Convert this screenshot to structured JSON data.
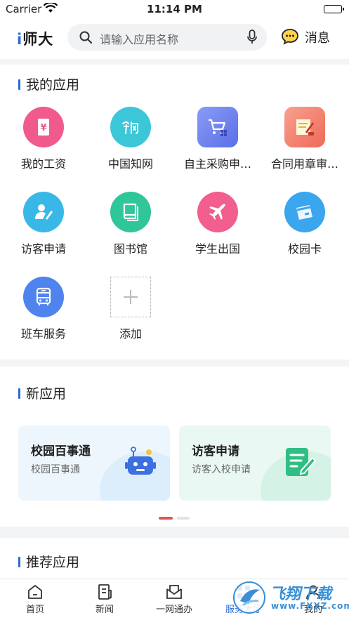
{
  "status_bar": {
    "carrier": "Carrier",
    "time": "11:14 PM"
  },
  "header": {
    "logo_prefix": "i",
    "logo_text": "师大",
    "search_placeholder": "请输入应用名称",
    "messages_label": "消息"
  },
  "my_apps": {
    "title": "我的应用",
    "items": [
      {
        "label": "我的工资",
        "icon": "salary-icon",
        "color": "#f05a8c"
      },
      {
        "label": "中国知网",
        "icon": "cnki-icon",
        "color": "#3cc7d8"
      },
      {
        "label": "自主采购申…",
        "icon": "shopping-cart-icon",
        "color": "#6a7df0"
      },
      {
        "label": "合同用章审…",
        "icon": "contract-stamp-icon",
        "color": "#f27b6a"
      },
      {
        "label": "访客申请",
        "icon": "visitor-icon",
        "color": "#39b8e8"
      },
      {
        "label": "图书馆",
        "icon": "book-icon",
        "color": "#2fc69a"
      },
      {
        "label": "学生出国",
        "icon": "airplane-icon",
        "color": "#f25e8d"
      },
      {
        "label": "校园卡",
        "icon": "card-icon",
        "color": "#3aa6ee"
      },
      {
        "label": "班车服务",
        "icon": "bus-icon",
        "color": "#4f83ee"
      }
    ],
    "add_label": "添加"
  },
  "new_apps": {
    "title": "新应用",
    "cards": [
      {
        "title": "校园百事通",
        "subtitle": "校园百事通",
        "icon": "robot-icon"
      },
      {
        "title": "访客申请",
        "subtitle": "访客入校申请",
        "icon": "form-edit-icon"
      }
    ]
  },
  "recommended": {
    "title": "推荐应用"
  },
  "tabbar": {
    "tabs": [
      {
        "label": "首页",
        "icon": "home-icon"
      },
      {
        "label": "新闻",
        "icon": "news-icon"
      },
      {
        "label": "一网通办",
        "icon": "mail-icon"
      },
      {
        "label": "服务大厅",
        "icon": "service-icon"
      },
      {
        "label": "我的",
        "icon": "profile-icon"
      }
    ],
    "active_index": 3
  },
  "watermark": {
    "title": "飞翔下载",
    "url": "www.FXXZ.com"
  }
}
